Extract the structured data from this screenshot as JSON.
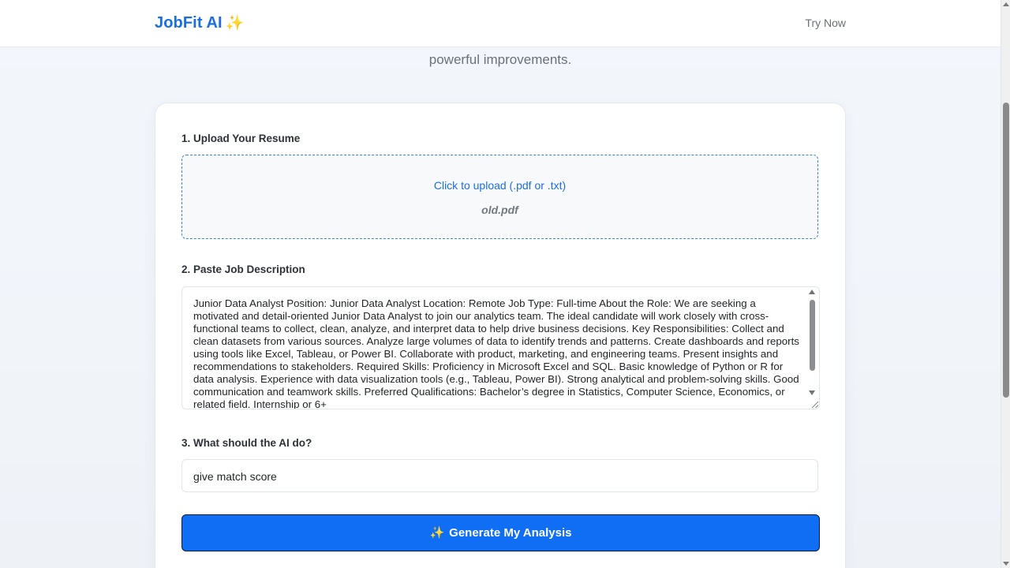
{
  "header": {
    "brand": "JobFit AI",
    "brand_icon": "✨",
    "nav_cta": "Try Now"
  },
  "hero": {
    "subtitle": "powerful improvements."
  },
  "form": {
    "step1": {
      "label": "1. Upload Your Resume",
      "upload_prompt": "Click to upload (.pdf or .txt)",
      "file_name": "old.pdf"
    },
    "step2": {
      "label": "2. Paste Job Description",
      "value": "Junior Data Analyst Position: Junior Data Analyst Location: Remote Job Type: Full-time  About the Role: We are seeking a motivated and detail-oriented Junior Data Analyst to join our analytics team. The ideal candidate will work closely with cross-functional teams to collect, clean, analyze, and interpret data to help drive business decisions.  Key Responsibilities: Collect and clean datasets from various sources.  Analyze large volumes of data to identify trends and patterns.  Create dashboards and reports using tools like Excel, Tableau, or Power BI.  Collaborate with product, marketing, and engineering teams.  Present insights and recommendations to stakeholders.  Required Skills: Proficiency in Microsoft Excel and SQL.  Basic knowledge of Python or R for data analysis.  Experience with data visualization tools (e.g., Tableau, Power BI).  Strong analytical and problem-solving skills.  Good communication and teamwork skills.  Preferred Qualifications: Bachelor’s degree in Statistics, Computer Science, Economics, or related field.  Internship or 6+"
    },
    "step3": {
      "label": "3. What should the AI do?",
      "value": "give match score"
    },
    "submit": {
      "icon": "✨",
      "label": "Generate My Analysis"
    }
  },
  "colors": {
    "brand": "#1a6fe0",
    "button": "#0f6ef3",
    "upload_border": "#3b83d9"
  }
}
